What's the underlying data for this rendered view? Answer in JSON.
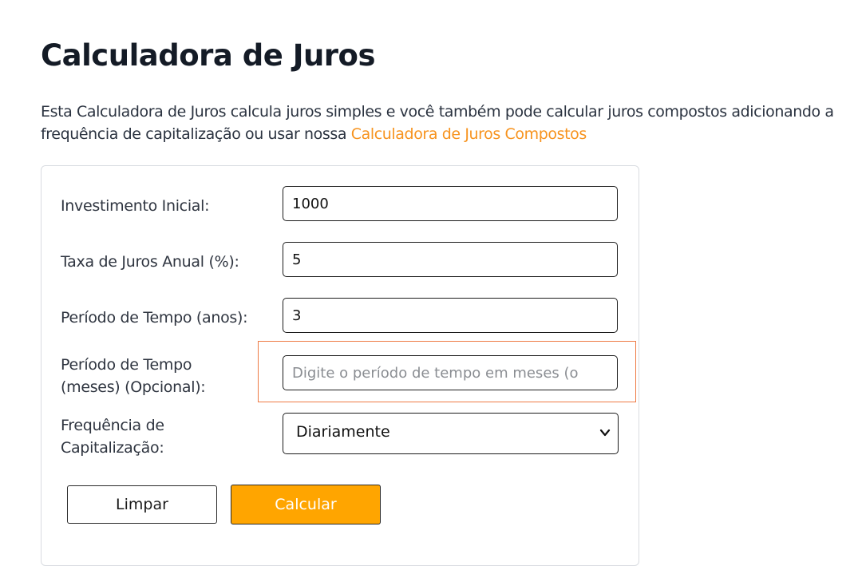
{
  "page": {
    "title": "Calculadora de Juros",
    "intro_text": "Esta Calculadora de Juros calcula juros simples e você também pode calcular juros compostos adicionando a frequência de capitalização ou usar nossa ",
    "intro_link": "Calculadora de Juros Compostos"
  },
  "form": {
    "initial_investment": {
      "label": "Investimento Inicial:",
      "value": "1000"
    },
    "annual_rate": {
      "label": "Taxa de Juros Anual (%):",
      "value": "5"
    },
    "period_years": {
      "label": "Período de Tempo (anos):",
      "value": "3"
    },
    "period_months": {
      "label_line1": "Período de Tempo",
      "label_line2": "(meses) (Opcional):",
      "value": "",
      "placeholder": "Digite o período de tempo em meses (o"
    },
    "compounding": {
      "label_line1": "Frequência de",
      "label_line2": "Capitalização:",
      "selected": "Diariamente"
    },
    "buttons": {
      "clear": "Limpar",
      "calculate": "Calcular"
    }
  },
  "colors": {
    "accent": "#f7931e",
    "calculate_button": "#ffa500",
    "highlight_border": "#ee7b45"
  }
}
